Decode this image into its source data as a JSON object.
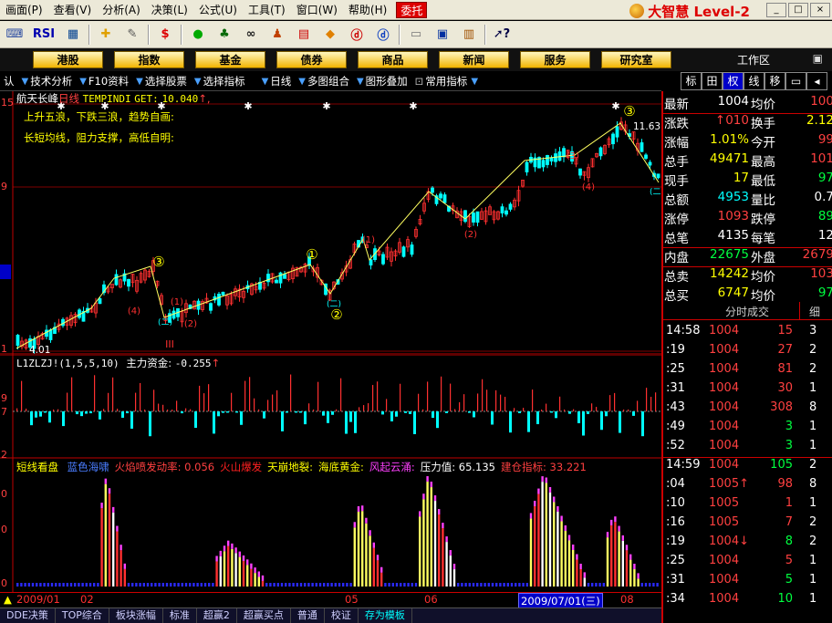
{
  "menu": {
    "items": [
      "画面(P)",
      "查看(V)",
      "分析(A)",
      "决策(L)",
      "公式(U)",
      "工具(T)",
      "窗口(W)",
      "帮助(H)"
    ],
    "trade": "委托",
    "brand": "大智慧 Level-2"
  },
  "toolbar": {
    "rsi": "RSI"
  },
  "nav": {
    "buttons": [
      "港股",
      "指数",
      "基金",
      "债券",
      "商品",
      "新闻",
      "服务",
      "研究室"
    ],
    "workarea": "工作区"
  },
  "funcbar": {
    "items": [
      "认",
      "技术分析",
      "F10资料",
      "选择股票",
      "选择指标",
      "日线",
      "多图组合",
      "图形叠加",
      "常用指标"
    ]
  },
  "right_tabs": [
    "标",
    "田",
    "权",
    "线",
    "移"
  ],
  "main_chart": {
    "stock": "航天长峰",
    "period": "日线",
    "indicator": "TEMPINDI",
    "get_label": "GET:",
    "get_value": "10.040",
    "annot1": "上升五浪，下跌三浪，趋势自画:",
    "annot2": "长短均线，阻力支撑，高低自明:",
    "high_label": "11.63",
    "low_label": "4.01",
    "y_labels": [
      "15",
      "9",
      "1"
    ],
    "wave_marks": [
      "①",
      "②",
      "③",
      "(4)",
      "(2)",
      "(1)",
      "(3)",
      "(4)",
      "(2)",
      "(1)",
      "(3)",
      "(4)",
      "III",
      "(二)",
      "(二)"
    ]
  },
  "sub1": {
    "name": "L1ZLZJ!",
    "params": "(1,5,5,10)",
    "label": "主力资金:",
    "value": "-0.255",
    "y_labels": [
      "9",
      "7",
      "2"
    ]
  },
  "sub2": {
    "name": "短线看盘",
    "items": [
      {
        "label": "蓝色海啸",
        "color": "#4a7dff"
      },
      {
        "label": "火焰喷发动率:",
        "value": "0.056",
        "color": "#ff4040"
      },
      {
        "label": "火山爆发",
        "color": "#ff2020"
      },
      {
        "label": "天崩地裂:",
        "color": "#ffff00"
      },
      {
        "label": "海底黄金:",
        "color": "#ffff00"
      },
      {
        "label": "风起云涌:",
        "color": "#ff40ff"
      },
      {
        "label": "压力值:",
        "value": "65.135",
        "color": "#ffffff"
      },
      {
        "label": "建仓指标:",
        "value": "33.221",
        "color": "#ff4040"
      }
    ],
    "y_labels": [
      "0",
      "0",
      "0"
    ]
  },
  "dates": {
    "labels": [
      "2009/01",
      "02",
      "05",
      "06",
      "08"
    ],
    "highlight": "2009/07/01(三)"
  },
  "bottom_tabs": [
    "DDE决策",
    "TOP综合",
    "板块涨幅",
    "标准",
    "超赢2",
    "超赢买点",
    "普通",
    "校证",
    "存为模板"
  ],
  "quote": {
    "rows": [
      {
        "l1": "最新",
        "v1": "1004",
        "c1": "#ffffff",
        "l2": "均价",
        "v2": "100",
        "c2": "#ff4040"
      },
      {
        "l1": "涨跌",
        "v1": "↑010",
        "c1": "#ff4040",
        "l2": "换手",
        "v2": "2.12",
        "c2": "#ffff00"
      },
      {
        "l1": "涨幅",
        "v1": "1.01%",
        "c1": "#ffff00",
        "l2": "今开",
        "v2": "99",
        "c2": "#ff4040"
      },
      {
        "l1": "总手",
        "v1": "49471",
        "c1": "#ffff00",
        "l2": "最高",
        "v2": "101",
        "c2": "#ff4040"
      },
      {
        "l1": "现手",
        "v1": "17",
        "c1": "#ffff00",
        "l2": "最低",
        "v2": "97",
        "c2": "#00ff40"
      },
      {
        "l1": "总额",
        "v1": "4953",
        "c1": "#00ffff",
        "l2": "量比",
        "v2": "0.7",
        "c2": "#ffffff"
      },
      {
        "l1": "涨停",
        "v1": "1093",
        "c1": "#ff4040",
        "l2": "跌停",
        "v2": "89",
        "c2": "#00ff40"
      },
      {
        "l1": "总笔",
        "v1": "4135",
        "c1": "#ffffff",
        "l2": "每笔",
        "v2": "12",
        "c2": "#ffffff"
      },
      {
        "l1": "内盘",
        "v1": "22675",
        "c1": "#00ff40",
        "l2": "外盘",
        "v2": "2679",
        "c2": "#ff4040"
      },
      {
        "l1": "总卖",
        "v1": "14242",
        "c1": "#ffff00",
        "l2": "均价",
        "v2": "103",
        "c2": "#ff4040"
      },
      {
        "l1": "总买",
        "v1": "6747",
        "c1": "#ffff00",
        "l2": "均价",
        "v2": "97",
        "c2": "#00ff40"
      }
    ]
  },
  "ticks": {
    "header": "分时成交",
    "header_right": "细",
    "rows": [
      {
        "t": "14:58",
        "p": "1004",
        "v": "15",
        "vc": "#ff4040",
        "n": "3"
      },
      {
        "t": ":19",
        "p": "1004",
        "v": "27",
        "vc": "#ff4040",
        "n": "2"
      },
      {
        "t": ":25",
        "p": "1004",
        "v": "81",
        "vc": "#ff4040",
        "n": "2"
      },
      {
        "t": ":31",
        "p": "1004",
        "v": "30",
        "vc": "#ff4040",
        "n": "1"
      },
      {
        "t": ":43",
        "p": "1004",
        "v": "308",
        "vc": "#ff4040",
        "n": "8"
      },
      {
        "t": ":49",
        "p": "1004",
        "v": "3",
        "vc": "#00ff40",
        "n": "1"
      },
      {
        "t": ":52",
        "p": "1004",
        "v": "3",
        "vc": "#00ff40",
        "n": "1"
      },
      {
        "t": "14:59",
        "p": "1004",
        "v": "105",
        "vc": "#00ff40",
        "n": "2"
      },
      {
        "t": ":04",
        "p": "1005↑",
        "v": "98",
        "vc": "#ff4040",
        "n": "8"
      },
      {
        "t": ":10",
        "p": "1005",
        "v": "1",
        "vc": "#ff4040",
        "n": "1"
      },
      {
        "t": ":16",
        "p": "1005",
        "v": "7",
        "vc": "#ff4040",
        "n": "2"
      },
      {
        "t": ":19",
        "p": "1004↓",
        "v": "8",
        "vc": "#00ff40",
        "n": "2"
      },
      {
        "t": ":25",
        "p": "1004",
        "v": "5",
        "vc": "#ff4040",
        "n": "1"
      },
      {
        "t": ":31",
        "p": "1004",
        "v": "5",
        "vc": "#00ff40",
        "n": "1"
      },
      {
        "t": ":34",
        "p": "1004",
        "v": "10",
        "vc": "#00ff40",
        "n": "1"
      }
    ]
  }
}
